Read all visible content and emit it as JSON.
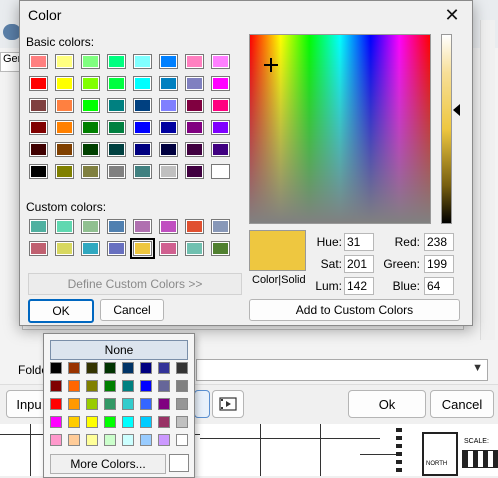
{
  "background": {
    "tab_label": "Gen",
    "folder_label": "Folde",
    "input_button": "Inpu",
    "ok_label": "Ok",
    "cancel_label": "Cancel",
    "north_label": "NORTH",
    "scale_label": "SCALE:"
  },
  "dialog": {
    "title": "Color",
    "basic_colors_label": "Basic colors:",
    "custom_colors_label": "Custom colors:",
    "basic_colors": [
      "#ff8080",
      "#ffff80",
      "#80ff80",
      "#00ff80",
      "#80ffff",
      "#0080ff",
      "#ff80c0",
      "#ff80ff",
      "#ff0000",
      "#ffff00",
      "#80ff00",
      "#00ff40",
      "#00ffff",
      "#0080c0",
      "#8080c0",
      "#ff00ff",
      "#804040",
      "#ff8040",
      "#00ff00",
      "#008080",
      "#004080",
      "#8080ff",
      "#800040",
      "#ff0080",
      "#800000",
      "#ff8000",
      "#008000",
      "#008040",
      "#0000ff",
      "#0000a0",
      "#800080",
      "#8000ff",
      "#400000",
      "#804000",
      "#004000",
      "#004040",
      "#000080",
      "#000040",
      "#400040",
      "#400080",
      "#000000",
      "#808000",
      "#808040",
      "#808080",
      "#408080",
      "#c0c0c0",
      "#400040",
      "#ffffff"
    ],
    "custom_colors": [
      "#50b0a0",
      "#60d8b0",
      "#90c090",
      "#5080b0",
      "#b070b0",
      "#c050c0",
      "#e05030",
      "#8898b8",
      "#c06070",
      "#d8d860",
      "#30a8c0",
      "#6870c0",
      "#eec740",
      "#d06090",
      "#70c0b0",
      "#508030"
    ],
    "selected_custom_index": 12,
    "define_custom_label": "Define Custom Colors >>",
    "ok_label": "OK",
    "cancel_label": "Cancel",
    "preview_label": "Color|Solid",
    "current_color": "#eec740",
    "hue_label": "Hue:",
    "sat_label": "Sat:",
    "lum_label": "Lum:",
    "red_label": "Red:",
    "green_label": "Green:",
    "blue_label": "Blue:",
    "hue": "31",
    "sat": "201",
    "lum": "142",
    "red": "238",
    "green": "199",
    "blue": "64",
    "add_custom_label": "Add to Custom Colors"
  },
  "popup": {
    "none_label": "None",
    "more_colors_label": "More Colors...",
    "colors": [
      "#000000",
      "#993300",
      "#333300",
      "#003300",
      "#003366",
      "#000080",
      "#333399",
      "#333333",
      "#800000",
      "#ff6600",
      "#808000",
      "#008000",
      "#008080",
      "#0000ff",
      "#666699",
      "#808080",
      "#ff0000",
      "#ff9900",
      "#99cc00",
      "#339966",
      "#33cccc",
      "#3366ff",
      "#800080",
      "#969696",
      "#ff00ff",
      "#ffcc00",
      "#ffff00",
      "#00ff00",
      "#00ffff",
      "#00ccff",
      "#993366",
      "#c0c0c0",
      "#ff99cc",
      "#ffcc99",
      "#ffff99",
      "#ccffcc",
      "#ccffff",
      "#99ccff",
      "#cc99ff",
      "#ffffff"
    ]
  }
}
